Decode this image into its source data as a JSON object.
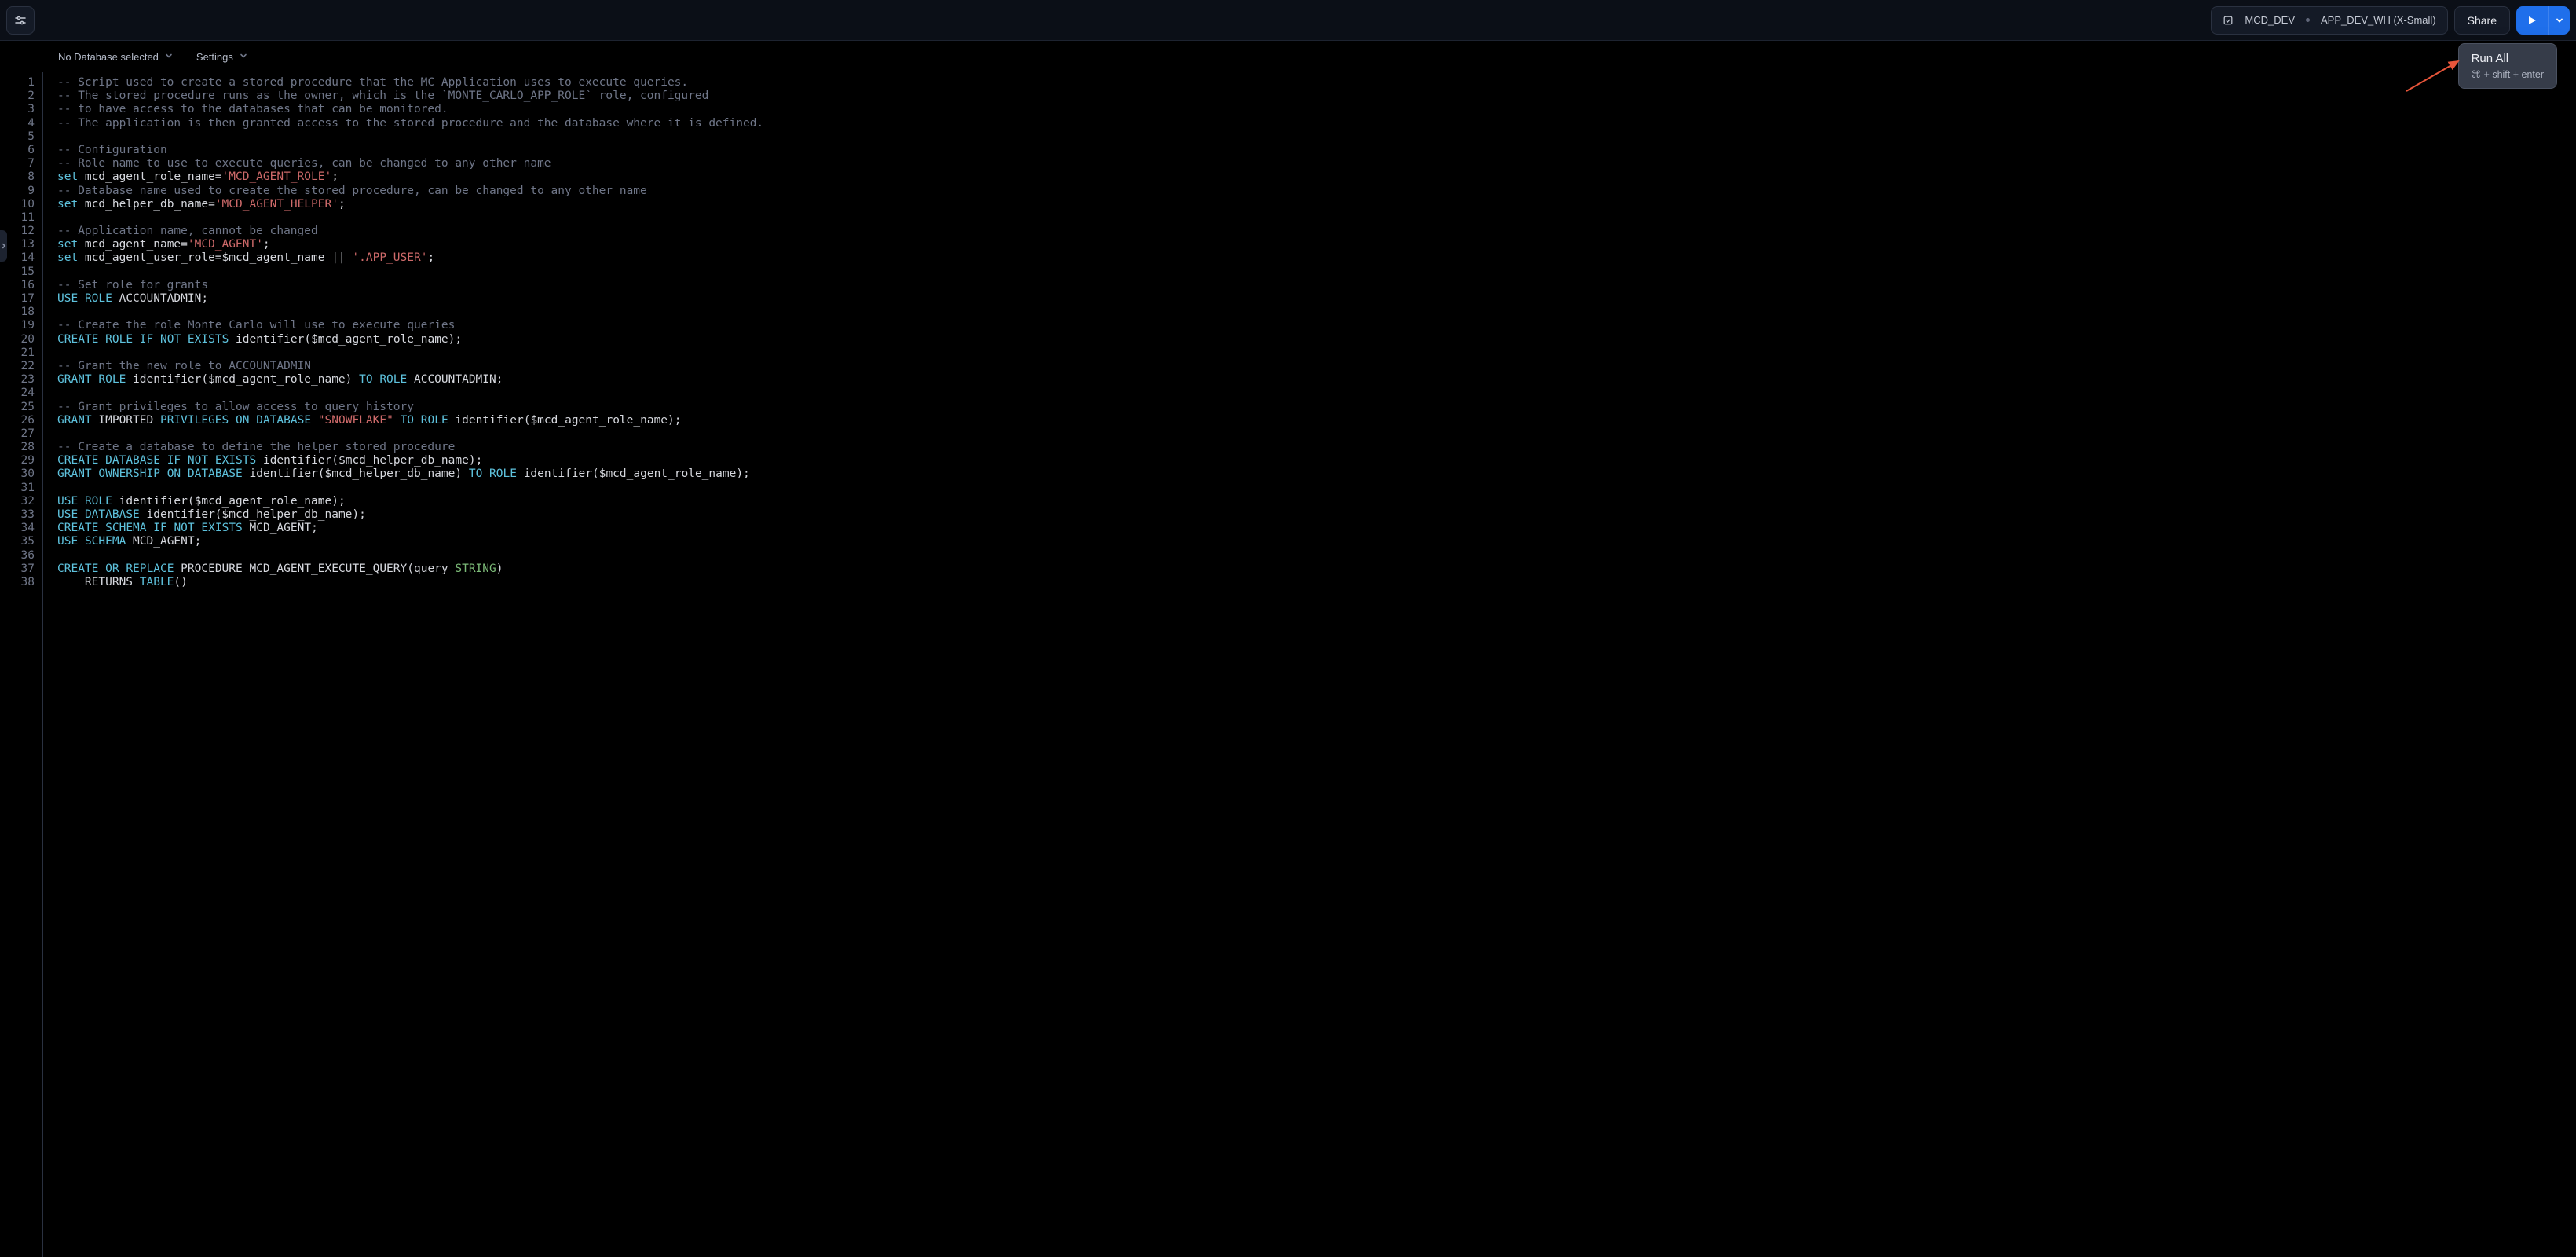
{
  "toolbar": {
    "role_name": "MCD_DEV",
    "warehouse": "APP_DEV_WH (X-Small)",
    "share": "Share"
  },
  "subbar": {
    "database": "No Database selected",
    "settings": "Settings"
  },
  "run_popup": {
    "title": "Run All",
    "hint": "⌘ + shift + enter"
  },
  "editor": {
    "lines": [
      [
        {
          "c": "cmt",
          "t": "-- Script used to create a stored procedure that the MC Application uses to execute queries."
        }
      ],
      [
        {
          "c": "cmt",
          "t": "-- The stored procedure runs as the owner, which is the `MONTE_CARLO_APP_ROLE` role, configured"
        }
      ],
      [
        {
          "c": "cmt",
          "t": "-- to have access to the databases that can be monitored."
        }
      ],
      [
        {
          "c": "cmt",
          "t": "-- The application is then granted access to the stored procedure and the database where it is defined."
        }
      ],
      [],
      [
        {
          "c": "cmt",
          "t": "-- Configuration"
        }
      ],
      [
        {
          "c": "cmt",
          "t": "-- Role name to use to execute queries, can be changed to any other name"
        }
      ],
      [
        {
          "c": "kw",
          "t": "set"
        },
        {
          "c": "id",
          "t": " mcd_agent_role_name="
        },
        {
          "c": "str",
          "t": "'MCD_AGENT_ROLE'"
        },
        {
          "c": "id",
          "t": ";"
        }
      ],
      [
        {
          "c": "cmt",
          "t": "-- Database name used to create the stored procedure, can be changed to any other name"
        }
      ],
      [
        {
          "c": "kw",
          "t": "set"
        },
        {
          "c": "id",
          "t": " mcd_helper_db_name="
        },
        {
          "c": "str",
          "t": "'MCD_AGENT_HELPER'"
        },
        {
          "c": "id",
          "t": ";"
        }
      ],
      [],
      [
        {
          "c": "cmt",
          "t": "-- Application name, cannot be changed"
        }
      ],
      [
        {
          "c": "kw",
          "t": "set"
        },
        {
          "c": "id",
          "t": " mcd_agent_name="
        },
        {
          "c": "str",
          "t": "'MCD_AGENT'"
        },
        {
          "c": "id",
          "t": ";"
        }
      ],
      [
        {
          "c": "kw",
          "t": "set"
        },
        {
          "c": "id",
          "t": " mcd_agent_user_role=$mcd_agent_name || "
        },
        {
          "c": "str",
          "t": "'.APP_USER'"
        },
        {
          "c": "id",
          "t": ";"
        }
      ],
      [],
      [
        {
          "c": "cmt",
          "t": "-- Set role for grants"
        }
      ],
      [
        {
          "c": "kw",
          "t": "USE"
        },
        {
          "c": "id",
          "t": " "
        },
        {
          "c": "kw",
          "t": "ROLE"
        },
        {
          "c": "id",
          "t": " ACCOUNTADMIN;"
        }
      ],
      [],
      [
        {
          "c": "cmt",
          "t": "-- Create the role Monte Carlo will use to execute queries"
        }
      ],
      [
        {
          "c": "kw",
          "t": "CREATE"
        },
        {
          "c": "id",
          "t": " "
        },
        {
          "c": "kw",
          "t": "ROLE"
        },
        {
          "c": "id",
          "t": " "
        },
        {
          "c": "kw",
          "t": "IF"
        },
        {
          "c": "id",
          "t": " "
        },
        {
          "c": "kw",
          "t": "NOT"
        },
        {
          "c": "id",
          "t": " "
        },
        {
          "c": "kw",
          "t": "EXISTS"
        },
        {
          "c": "id",
          "t": " identifier($mcd_agent_role_name);"
        }
      ],
      [],
      [
        {
          "c": "cmt",
          "t": "-- Grant the new role to ACCOUNTADMIN"
        }
      ],
      [
        {
          "c": "kw",
          "t": "GRANT"
        },
        {
          "c": "id",
          "t": " "
        },
        {
          "c": "kw",
          "t": "ROLE"
        },
        {
          "c": "id",
          "t": " identifier($mcd_agent_role_name) "
        },
        {
          "c": "kw",
          "t": "TO"
        },
        {
          "c": "id",
          "t": " "
        },
        {
          "c": "kw",
          "t": "ROLE"
        },
        {
          "c": "id",
          "t": " ACCOUNTADMIN;"
        }
      ],
      [],
      [
        {
          "c": "cmt",
          "t": "-- Grant privileges to allow access to query history"
        }
      ],
      [
        {
          "c": "kw",
          "t": "GRANT"
        },
        {
          "c": "id",
          "t": " IMPORTED "
        },
        {
          "c": "kw",
          "t": "PRIVILEGES"
        },
        {
          "c": "id",
          "t": " "
        },
        {
          "c": "kw",
          "t": "ON"
        },
        {
          "c": "id",
          "t": " "
        },
        {
          "c": "kw",
          "t": "DATABASE"
        },
        {
          "c": "id",
          "t": " "
        },
        {
          "c": "str",
          "t": "\"SNOWFLAKE\""
        },
        {
          "c": "id",
          "t": " "
        },
        {
          "c": "kw",
          "t": "TO"
        },
        {
          "c": "id",
          "t": " "
        },
        {
          "c": "kw",
          "t": "ROLE"
        },
        {
          "c": "id",
          "t": " identifier($mcd_agent_role_name);"
        }
      ],
      [],
      [
        {
          "c": "cmt",
          "t": "-- Create a database to define the helper stored procedure"
        }
      ],
      [
        {
          "c": "kw",
          "t": "CREATE"
        },
        {
          "c": "id",
          "t": " "
        },
        {
          "c": "kw",
          "t": "DATABASE"
        },
        {
          "c": "id",
          "t": " "
        },
        {
          "c": "kw",
          "t": "IF"
        },
        {
          "c": "id",
          "t": " "
        },
        {
          "c": "kw",
          "t": "NOT"
        },
        {
          "c": "id",
          "t": " "
        },
        {
          "c": "kw",
          "t": "EXISTS"
        },
        {
          "c": "id",
          "t": " identifier($mcd_helper_db_name);"
        }
      ],
      [
        {
          "c": "kw",
          "t": "GRANT"
        },
        {
          "c": "id",
          "t": " "
        },
        {
          "c": "kw",
          "t": "OWNERSHIP"
        },
        {
          "c": "id",
          "t": " "
        },
        {
          "c": "kw",
          "t": "ON"
        },
        {
          "c": "id",
          "t": " "
        },
        {
          "c": "kw",
          "t": "DATABASE"
        },
        {
          "c": "id",
          "t": " identifier($mcd_helper_db_name) "
        },
        {
          "c": "kw",
          "t": "TO"
        },
        {
          "c": "id",
          "t": " "
        },
        {
          "c": "kw",
          "t": "ROLE"
        },
        {
          "c": "id",
          "t": " identifier($mcd_agent_role_name);"
        }
      ],
      [],
      [
        {
          "c": "kw",
          "t": "USE"
        },
        {
          "c": "id",
          "t": " "
        },
        {
          "c": "kw",
          "t": "ROLE"
        },
        {
          "c": "id",
          "t": " identifier($mcd_agent_role_name);"
        }
      ],
      [
        {
          "c": "kw",
          "t": "USE"
        },
        {
          "c": "id",
          "t": " "
        },
        {
          "c": "kw",
          "t": "DATABASE"
        },
        {
          "c": "id",
          "t": " identifier($mcd_helper_db_name);"
        }
      ],
      [
        {
          "c": "kw",
          "t": "CREATE"
        },
        {
          "c": "id",
          "t": " "
        },
        {
          "c": "kw",
          "t": "SCHEMA"
        },
        {
          "c": "id",
          "t": " "
        },
        {
          "c": "kw",
          "t": "IF"
        },
        {
          "c": "id",
          "t": " "
        },
        {
          "c": "kw",
          "t": "NOT"
        },
        {
          "c": "id",
          "t": " "
        },
        {
          "c": "kw",
          "t": "EXISTS"
        },
        {
          "c": "id",
          "t": " MCD_AGENT;"
        }
      ],
      [
        {
          "c": "kw",
          "t": "USE"
        },
        {
          "c": "id",
          "t": " "
        },
        {
          "c": "kw",
          "t": "SCHEMA"
        },
        {
          "c": "id",
          "t": " MCD_AGENT;"
        }
      ],
      [],
      [
        {
          "c": "kw",
          "t": "CREATE"
        },
        {
          "c": "id",
          "t": " "
        },
        {
          "c": "kw",
          "t": "OR"
        },
        {
          "c": "id",
          "t": " "
        },
        {
          "c": "kw",
          "t": "REPLACE"
        },
        {
          "c": "id",
          "t": " PROCEDURE MCD_AGENT_EXECUTE_QUERY(query "
        },
        {
          "c": "type",
          "t": "STRING"
        },
        {
          "c": "id",
          "t": ")"
        }
      ],
      [
        {
          "c": "id",
          "t": "    RETURNS "
        },
        {
          "c": "kw",
          "t": "TABLE"
        },
        {
          "c": "id",
          "t": "()"
        }
      ]
    ]
  }
}
